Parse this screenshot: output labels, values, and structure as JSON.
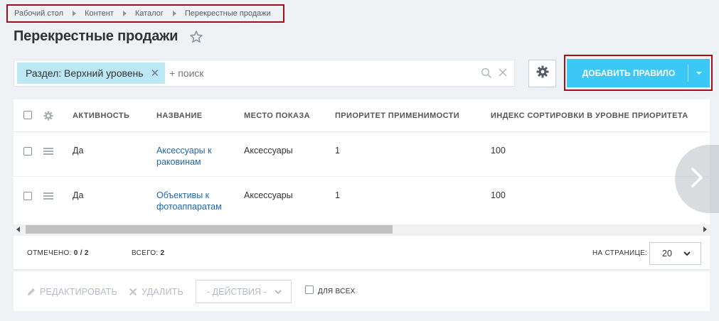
{
  "breadcrumb": [
    "Рабочий стол",
    "Контент",
    "Каталог",
    "Перекрестные продажи"
  ],
  "page_title": "Перекрестные продажи",
  "filter": {
    "chip_label": "Раздел: Верхний уровень",
    "placeholder": "+ поиск"
  },
  "add_button": {
    "label": "ДОБАВИТЬ ПРАВИЛО",
    "color": "#3bc8f5"
  },
  "table": {
    "columns": [
      "АКТИВНОСТЬ",
      "НАЗВАНИЕ",
      "МЕСТО ПОКАЗА",
      "ПРИОРИТЕТ ПРИМЕНИМОСТИ",
      "ИНДЕКС СОРТИРОВКИ В УРОВНЕ ПРИОРИТЕТА"
    ],
    "rows": [
      {
        "active": "Да",
        "name_line1": "Аксессуары к",
        "name_line2": "раковинам",
        "place": "Аксессуары",
        "priority": "1",
        "sort": "100"
      },
      {
        "active": "Да",
        "name_line1": "Объективы к",
        "name_line2": "фотоаппаратам",
        "place": "Аксессуары",
        "priority": "1",
        "sort": "100"
      }
    ]
  },
  "footer": {
    "selected_label": "ОТМЕЧЕНО:",
    "selected_value": "0 / 2",
    "total_label": "ВСЕГО:",
    "total_value": "2",
    "per_page_label": "НА СТРАНИЦЕ:",
    "per_page_value": "20"
  },
  "actions": {
    "edit": "РЕДАКТИРОВАТЬ",
    "delete": "УДАЛИТЬ",
    "select": "- ДЕЙСТВИЯ -",
    "for_all": "ДЛЯ ВСЕХ"
  },
  "icons": [
    "star-icon",
    "search-icon",
    "close-icon",
    "gear-icon",
    "chevron-down-icon",
    "drag-handle-icon",
    "pencil-icon",
    "chevron-right-icon"
  ]
}
